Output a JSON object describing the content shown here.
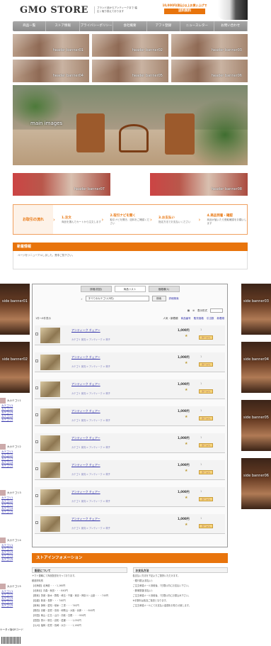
{
  "header": {
    "logo": "GMO STORE",
    "tagline": "ブランド品からアンティークまで 幅広く取り揃えております",
    "promo_top": "10,000円(税込)以上お買い上げで",
    "promo_button": "送料無料"
  },
  "nav": [
    "商品一覧",
    "ストア情報",
    "プライバシーポリシー",
    "会社概要",
    "アフト登録",
    "ニュースレター",
    "お問い合わせ"
  ],
  "header_banners": [
    "header banner01",
    "header banner02",
    "header banner03",
    "header banner04",
    "header banner05",
    "header banner06"
  ],
  "main_image_label": "main images",
  "banners_row2": [
    "header banner07",
    "header banner08"
  ],
  "flow": {
    "title": "お取引の流れ",
    "steps": [
      {
        "title": "1.注文",
        "desc": "商品を選んでカートから注文します"
      },
      {
        "title": "2.取引ナビを開く",
        "desc": "取引ナビを開き、送料をご確認ください"
      },
      {
        "title": "3.お支払い",
        "desc": "指定方法でお支払いください"
      },
      {
        "title": "4.商品到着・確認",
        "desc": "商品が届いたら受取確認をお願いします"
      }
    ]
  },
  "news": {
    "heading": "新着情報",
    "body": "ページをリニューアルしました。是非ご覧下さい。"
  },
  "side_left": [
    "side banner01",
    "side banner02"
  ],
  "side_right": [
    "side banner03",
    "side banner04",
    "side banner05",
    "side banner06"
  ],
  "categories": [
    {
      "head": "大カテゴリ1",
      "items": [
        "カテゴリ1",
        "カテゴリ2",
        "カテゴリ3",
        "カテゴリ4",
        "カテゴリ5"
      ]
    },
    {
      "head": "大カテゴリ2",
      "items": [
        "カテゴリ1",
        "カテゴリ2",
        "カテゴリ3",
        "カテゴリ4",
        "カテゴリ5"
      ]
    },
    {
      "head": "大カテゴリ3",
      "items": [
        "カテゴリ1",
        "カテゴリ2",
        "カテゴリ3",
        "カテゴリ4",
        "カテゴリ5"
      ]
    },
    {
      "head": "大カテゴリ4",
      "items": [
        "カテゴリ1",
        "カテゴリ2",
        "カテゴリ3",
        "カテゴリ4",
        "カテゴリ5"
      ]
    },
    {
      "head": "大カテゴリ5",
      "items": [
        "カテゴリ1",
        "カテゴリ2",
        "カテゴリ3",
        "カテゴリ4",
        "カテゴリ5"
      ]
    }
  ],
  "qr_label": "ケータイ版QRコード",
  "panel": {
    "tabs": [
      "詳細(初回)",
      "商品リスト",
      "価格順(1)"
    ],
    "category_select": "すべてのカテゴリ(5件)",
    "search_button": "検索",
    "advanced_search": "詳細検索",
    "display_label": "表示形式",
    "list_header_left": "1件～8件表示",
    "sort_label": "人気・新着順",
    "sort_links": [
      "商品番号",
      "販売価格",
      "引当数",
      "新着順"
    ],
    "products": [
      {
        "name": "アンティーク チェアー",
        "crumb": "カテゴリ 家具 > アンティーク > 椅子",
        "price": "1,000円"
      },
      {
        "name": "アンティーク チェアー",
        "crumb": "カテゴリ 家具 > アンティーク > 椅子",
        "price": "1,000円"
      },
      {
        "name": "アンティーク チェアー",
        "crumb": "カテゴリ 家具 > アンティーク > 椅子",
        "price": "1,000円"
      },
      {
        "name": "アンティーク チェアー",
        "crumb": "カテゴリ 家具 > アンティーク > 椅子",
        "price": "1,000円"
      },
      {
        "name": "アンティーク チェアー",
        "crumb": "カテゴリ 家具 > アンティーク > 椅子",
        "price": "1,000円"
      },
      {
        "name": "アンティーク チェアー",
        "crumb": "カテゴリ 家具 > アンティーク > 椅子",
        "price": "1,000円"
      },
      {
        "name": "アンティーク チェアー",
        "crumb": "カテゴリ 家具 > アンティーク > 椅子",
        "price": "1,000円"
      },
      {
        "name": "アンティーク チェアー",
        "crumb": "カテゴリ 家具 > アンティーク > 椅子",
        "price": "1,000円"
      }
    ],
    "qty": "1",
    "cart_label": "カートへ"
  },
  "info": {
    "heading": "ストアインフォメーション",
    "left_head": "配送について",
    "left_lines": [
      "ヤマト運輸にて商品配送を行っております。",
      "都道府県別",
      "【北海道】北海道・・・1,160円",
      "【北東北】青森・秋田・・・840円",
      "【関東】茨城・栃木・群馬・埼玉・千葉・東京・神奈川・山梨・・・740円",
      "【信越】新潟・長野・・・740円",
      "【東海】静岡・愛知・岐阜・三重・・・740円",
      "【関西】京都・滋賀・奈良・和歌山・大阪・兵庫・・・840円",
      "【中国】岡山・広島・山口・鳥取・島根・・・950円",
      "【四国】香川・徳島・高知・愛媛・・・1,050円",
      "【九州】福岡・佐賀・長崎・大分・・・1,160円"
    ],
    "right_head": "お支払方法",
    "right_lines": [
      "各支払い方法を下記よりご選択いただけます。",
      "・銀行振込(前払い)",
      "ご注文承諾メール到着後、7日間以内にお支払い下さい。",
      "・郵便振替(前払い)",
      "ご注文承諾メール到着後、7日間以内にお振込み下さい。",
      "※手数料は各自ご負担となります。",
      "ご注文承諾メールにてお支払い金額をお知らせ致します。"
    ]
  }
}
